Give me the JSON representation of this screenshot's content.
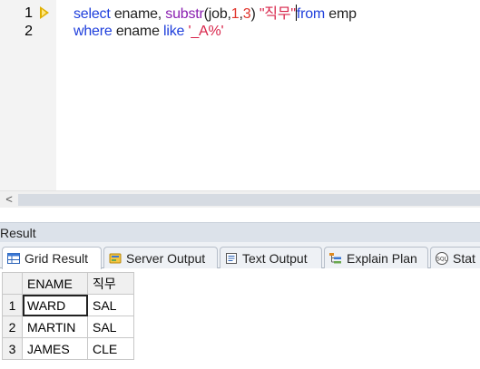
{
  "editor": {
    "line_numbers": [
      "1",
      "2"
    ],
    "line1": {
      "kw_select": "select",
      "plain1": " ename, ",
      "fn_substr": "substr",
      "plain2": "(job,",
      "num1": "1",
      "comma": ",",
      "num3": "3",
      "plain3": ") ",
      "alias": "\"직무\"",
      "kw_from": "from",
      "plain4": " emp"
    },
    "line2": {
      "kw_where": "where",
      "plain1": " ename ",
      "kw_like": "like",
      "plain2": " ",
      "pattern": "'_A%'"
    }
  },
  "scrollbar": {
    "left_arrow": "<"
  },
  "result": {
    "title": "Result",
    "tabs": [
      {
        "label": "Grid Result",
        "icon": "grid-icon",
        "active": true
      },
      {
        "label": "Server Output",
        "icon": "server-output-icon",
        "active": false
      },
      {
        "label": "Text Output",
        "icon": "text-output-icon",
        "active": false
      },
      {
        "label": "Explain Plan",
        "icon": "explain-plan-icon",
        "active": false
      },
      {
        "label": "Stat",
        "icon": "sql-stat-icon",
        "active": false
      }
    ],
    "grid": {
      "columns": [
        "ENAME",
        "직무"
      ],
      "rows": [
        {
          "num": "1",
          "cells": [
            "WARD",
            "SAL"
          ]
        },
        {
          "num": "2",
          "cells": [
            "MARTIN",
            "SAL"
          ]
        },
        {
          "num": "3",
          "cells": [
            "JAMES",
            "CLE"
          ]
        }
      ]
    }
  },
  "colors": {
    "keyword": "#1f3fdc",
    "function": "#8a1eb0",
    "number": "#e0342b",
    "string": "#d8244a",
    "marker": "#e0b000"
  }
}
